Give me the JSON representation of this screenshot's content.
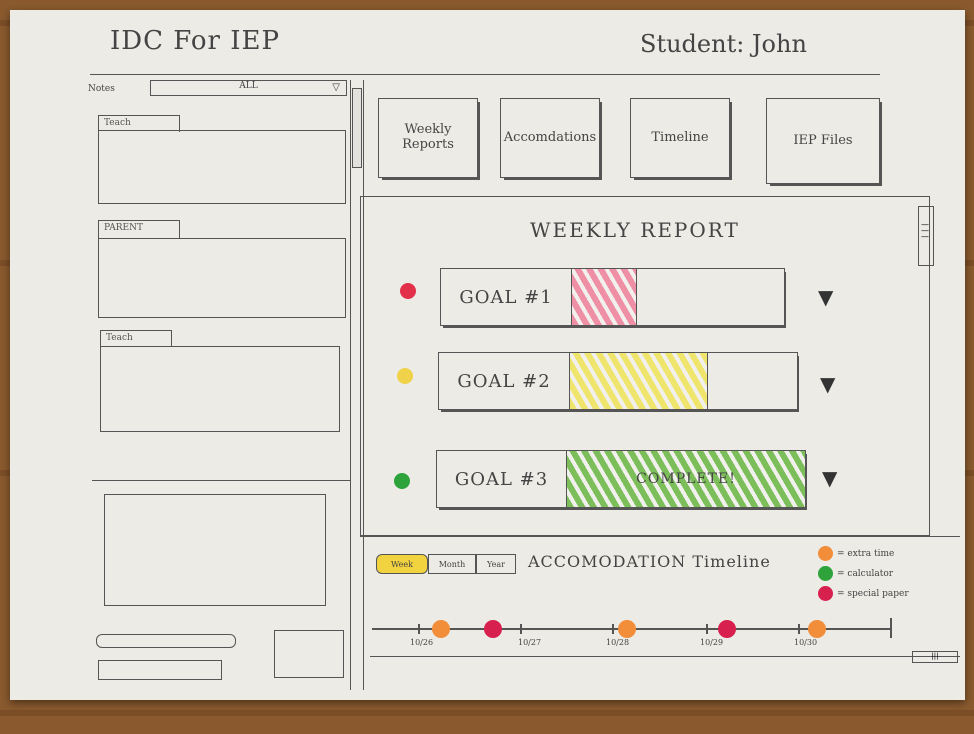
{
  "header": {
    "title": "IDC For IEP",
    "student": "Student: John"
  },
  "sidebar": {
    "notes_label": "Notes",
    "filter_value": "ALL",
    "sections": [
      {
        "label": "Teach"
      },
      {
        "label": "PARENT"
      },
      {
        "label": "Teach"
      }
    ]
  },
  "nav": {
    "buttons": [
      {
        "label": "Weekly Reports"
      },
      {
        "label": "Accomdations"
      },
      {
        "label": "Timeline"
      },
      {
        "label": "IEP Files"
      }
    ]
  },
  "report": {
    "title": "WEEKLY REPORT",
    "goals": [
      {
        "label": "GOAL #1",
        "status_color": "#e2304a",
        "progress": 0.3,
        "fill_color": "#ee8fa6",
        "text": ""
      },
      {
        "label": "GOAL #2",
        "status_color": "#efd24a",
        "progress": 0.6,
        "fill_color": "#f0e56c",
        "text": ""
      },
      {
        "label": "GOAL #3",
        "status_color": "#2ea33c",
        "progress": 1.0,
        "fill_color": "#7cbf5a",
        "text": "COMPLETE!"
      }
    ]
  },
  "timeline": {
    "title": "ACCOMODATION Timeline",
    "range_options": [
      "Week",
      "Month",
      "Year"
    ],
    "selected_range": "Week",
    "legend": [
      {
        "label": "= extra time",
        "color": "#f28d3a"
      },
      {
        "label": "= calculator",
        "color": "#2ea33c"
      },
      {
        "label": "= special paper",
        "color": "#d8204f"
      }
    ],
    "dates": [
      "10/26",
      "10/27",
      "10/28",
      "10/29",
      "10/30"
    ],
    "events": [
      {
        "date": "10/26",
        "type": "extra time",
        "color": "#f28d3a"
      },
      {
        "date": "10/27",
        "type": "special paper",
        "color": "#d8204f"
      },
      {
        "date": "10/28",
        "type": "extra time",
        "color": "#f28d3a"
      },
      {
        "date": "10/29",
        "type": "special paper",
        "color": "#d8204f"
      },
      {
        "date": "10/30",
        "type": "extra time",
        "color": "#f28d3a"
      }
    ]
  }
}
